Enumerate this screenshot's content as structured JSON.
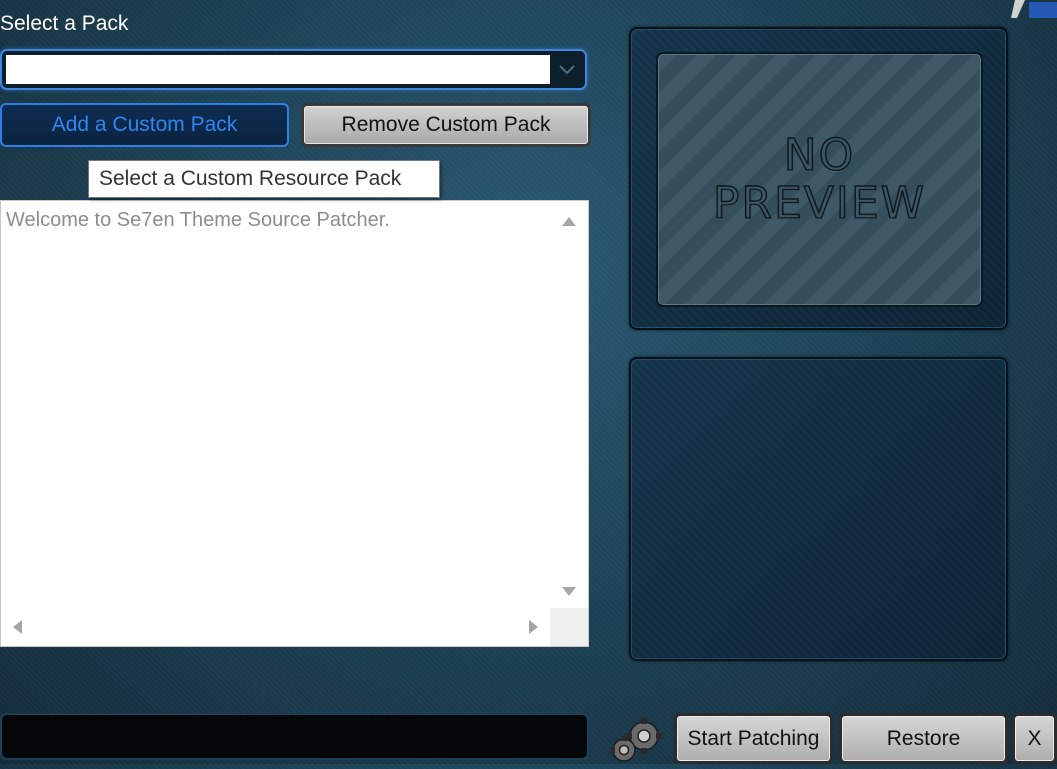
{
  "pack": {
    "label": "Select a Pack",
    "selected_value": "",
    "add_label": "Add a Custom Pack",
    "remove_label": "Remove Custom Pack"
  },
  "tooltip": "Select a Custom Resource Pack",
  "log": {
    "text": "Welcome to Se7en Theme Source Patcher."
  },
  "preview": {
    "line1": "NO",
    "line2": "PREVIEW"
  },
  "status": {
    "text": ""
  },
  "actions": {
    "start_label": "Start Patching",
    "restore_label": "Restore",
    "close_label": "X"
  },
  "icons": {
    "dropdown": "chevron-down-icon",
    "progress": "gears-icon",
    "corner": "logo-icon"
  },
  "colors": {
    "accent": "#2f7fe6",
    "background": "#1f465b"
  }
}
